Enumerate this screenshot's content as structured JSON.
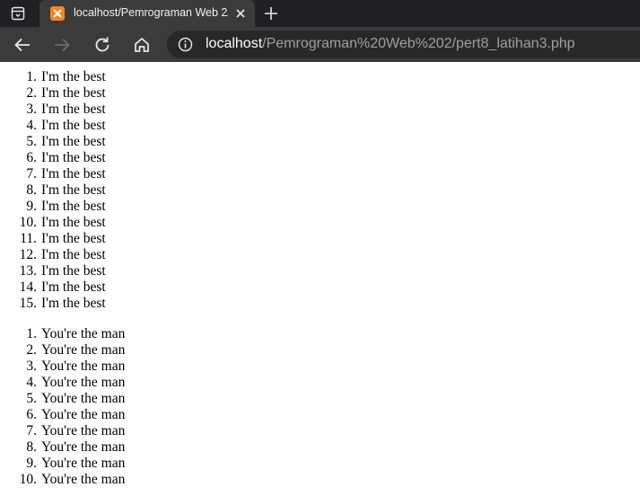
{
  "browser": {
    "tab": {
      "title": "localhost/Pemrograman Web 2/pert8_latihan3.php"
    },
    "address": {
      "host": "localhost",
      "path": "/Pemrograman%20Web%202/pert8_latihan3.php"
    }
  },
  "page": {
    "list1": [
      "I'm the best",
      "I'm the best",
      "I'm the best",
      "I'm the best",
      "I'm the best",
      "I'm the best",
      "I'm the best",
      "I'm the best",
      "I'm the best",
      "I'm the best",
      "I'm the best",
      "I'm the best",
      "I'm the best",
      "I'm the best",
      "I'm the best"
    ],
    "list2": [
      "You're the man",
      "You're the man",
      "You're the man",
      "You're the man",
      "You're the man",
      "You're the man",
      "You're the man",
      "You're the man",
      "You're the man",
      "You're the man"
    ]
  }
}
